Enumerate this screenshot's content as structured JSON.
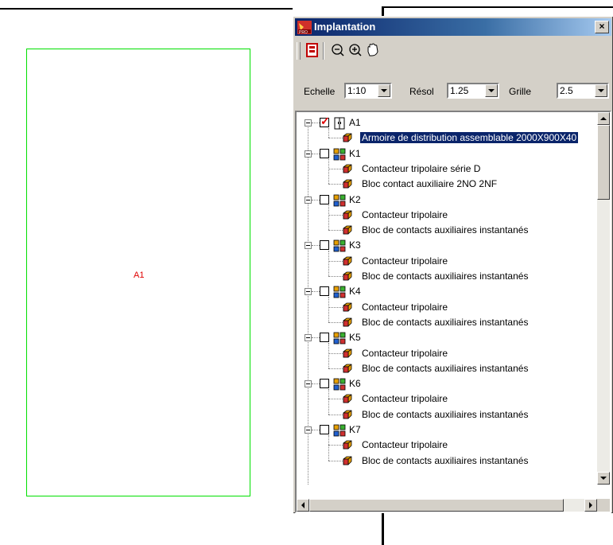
{
  "canvas": {
    "cabinet_label": "A1",
    "cabinet_color": "#00e000",
    "label_color": "#e00000"
  },
  "window": {
    "title": "Implantation",
    "close_label": "×"
  },
  "toolbar": {
    "items": [
      "layout-icon",
      "zoom-out-icon",
      "zoom-in-icon",
      "pan-hand-icon"
    ]
  },
  "settings": {
    "echelle_label": "Echelle",
    "echelle_value": "1:10",
    "resol_label": "Résol",
    "resol_value": "1.25",
    "grille_label": "Grille",
    "grille_value": "2.5"
  },
  "tree": {
    "nodes": [
      {
        "label": "A1",
        "checked": true,
        "icon": "cabinet-icon",
        "children": [
          "Armoire de distribution assemblable 2000X900X40"
        ]
      },
      {
        "label": "K1",
        "checked": false,
        "icon": "group-icon",
        "children": [
          "Contacteur tripolaire série D",
          "Bloc contact auxiliaire  2NO 2NF"
        ]
      },
      {
        "label": "K2",
        "checked": false,
        "icon": "group-icon",
        "children": [
          "Contacteur tripolaire",
          "Bloc de contacts auxiliaires instantanés"
        ]
      },
      {
        "label": "K3",
        "checked": false,
        "icon": "group-icon",
        "children": [
          "Contacteur tripolaire",
          "Bloc de contacts auxiliaires instantanés"
        ]
      },
      {
        "label": "K4",
        "checked": false,
        "icon": "group-icon",
        "children": [
          "Contacteur tripolaire",
          "Bloc de contacts auxiliaires instantanés"
        ]
      },
      {
        "label": "K5",
        "checked": false,
        "icon": "group-icon",
        "children": [
          "Contacteur tripolaire",
          "Bloc de contacts auxiliaires instantanés"
        ]
      },
      {
        "label": "K6",
        "checked": false,
        "icon": "group-icon",
        "children": [
          "Contacteur tripolaire",
          "Bloc de contacts auxiliaires instantanés"
        ]
      },
      {
        "label": "K7",
        "checked": false,
        "icon": "group-icon",
        "children": [
          "Contacteur tripolaire",
          "Bloc de contacts auxiliaires instantanés"
        ]
      }
    ],
    "selected": "Armoire de distribution assemblable 2000X900X40"
  }
}
